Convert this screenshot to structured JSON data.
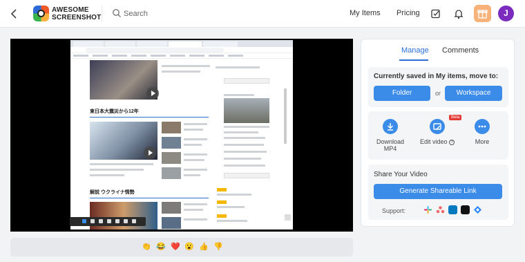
{
  "header": {
    "brand_line1": "AWESOME",
    "brand_line2": "SCREENSHOT",
    "search_placeholder": "Search",
    "my_items": "My Items",
    "pricing": "Pricing",
    "avatar_initial": "J",
    "icons": [
      "back-arrow-icon",
      "search-icon",
      "checklist-icon",
      "bell-icon",
      "gift-icon"
    ],
    "accent_color": "#2b6fd6",
    "gift_color": "#f7b27a",
    "avatar_color": "#7b2cbf"
  },
  "video": {
    "captured_page": {
      "heading_1": "東日本大震災から12年",
      "heading_2": "解説 ウクライナ情勢"
    }
  },
  "reactions": [
    "👏",
    "😂",
    "❤️",
    "😮",
    "👍",
    "👎"
  ],
  "side_panel": {
    "tabs": [
      "Manage",
      "Comments"
    ],
    "active_tab": "Manage",
    "move_card": {
      "title": "Currently saved in My items, move to:",
      "folder_label": "Folder",
      "or_label": "or",
      "workspace_label": "Workspace"
    },
    "actions": [
      {
        "label": "Download MP4",
        "icon": "download-icon"
      },
      {
        "label": "Edit video",
        "icon": "edit-video-icon",
        "badge": "Beta"
      },
      {
        "label": "More",
        "icon": "more-icon"
      }
    ],
    "share_card": {
      "title": "Share Your Video",
      "button_label": "Generate Shareable Link",
      "support_label": "Support:",
      "support_icons": [
        "slack-icon",
        "asana-icon",
        "trello-icon",
        "github-icon",
        "jira-icon"
      ]
    },
    "button_color": "#3b8be8"
  }
}
